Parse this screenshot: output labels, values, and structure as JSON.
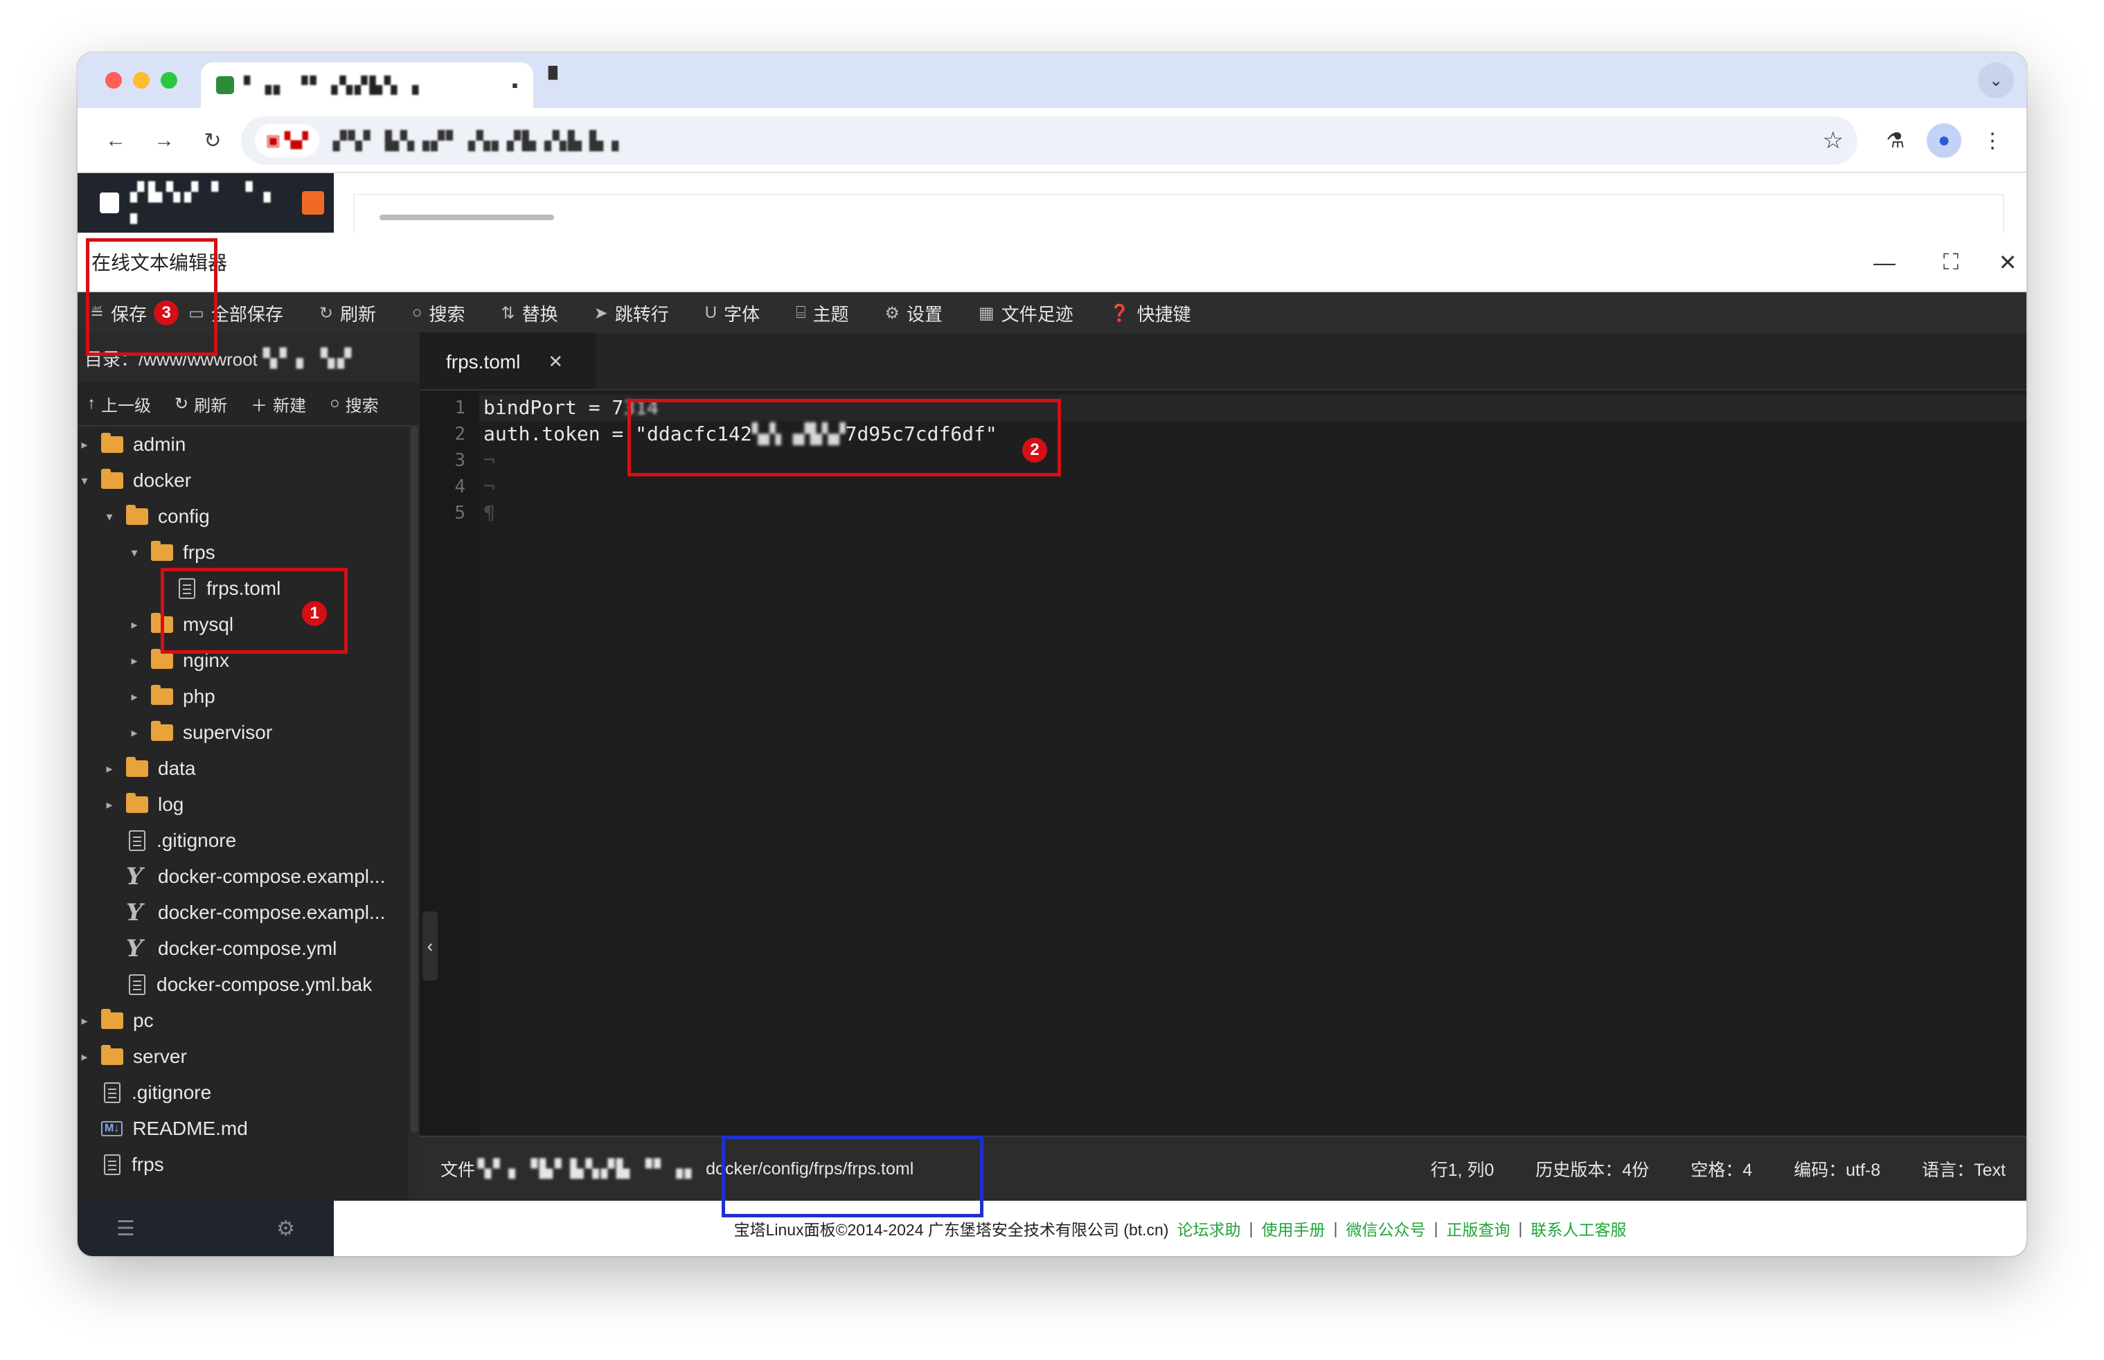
{
  "browser": {
    "tab_title": "▘▗▖ ▝▘▗▚▞▙▚ ▗",
    "tab_close": "▪",
    "new_tab": "▘",
    "tab_menu": "⌄",
    "chip_text": "▣ ▚▞",
    "url": "▞▚▘ ▙▚▗▞▘▗▚▖▞▙▗▚▙ ▙▗",
    "back": "←",
    "forward": "→",
    "reload": "↻",
    "star": "☆",
    "labs": "⚗",
    "profile": "●",
    "menu": "⋮"
  },
  "panel": {
    "logo_text": "▞▙▚▞ ▘ ▝▗ ▖"
  },
  "dialog": {
    "title": "在线文本编辑器",
    "minimize": "—",
    "maximize": "⛶",
    "close": "✕"
  },
  "toolbar": {
    "save": "保存",
    "save_badge": "3",
    "save_all": "全部保存",
    "refresh": "刷新",
    "search": "搜索",
    "replace": "替换",
    "goto": "跳转行",
    "font": "字体",
    "theme": "主题",
    "settings": "设置",
    "history": "文件足迹",
    "shortcuts": "快捷键"
  },
  "sidebar": {
    "path_label": "目录：/www/wwwroot",
    "path_blur": "▚▘▖ ▚▞",
    "up": "上一级",
    "refresh": "刷新",
    "new": "新建",
    "search": "搜索",
    "tree": [
      {
        "label": "admin"
      },
      {
        "label": "docker"
      },
      {
        "label": "config"
      },
      {
        "label": "frps"
      },
      {
        "label": "frps.toml"
      },
      {
        "label": "mysql"
      },
      {
        "label": "nginx"
      },
      {
        "label": "php"
      },
      {
        "label": "supervisor"
      },
      {
        "label": "data"
      },
      {
        "label": "log"
      },
      {
        "label": ".gitignore"
      },
      {
        "label": "docker-compose.exampl..."
      },
      {
        "label": "docker-compose.exampl..."
      },
      {
        "label": "docker-compose.yml"
      },
      {
        "label": "docker-compose.yml.bak"
      },
      {
        "label": "pc"
      },
      {
        "label": "server"
      },
      {
        "label": ".gitignore"
      },
      {
        "label": "README.md"
      },
      {
        "label": "frps"
      }
    ],
    "badge_1": "1"
  },
  "editor": {
    "tab_label": "frps.toml",
    "tab_close": "✕",
    "line_numbers": [
      "1",
      "2",
      "3",
      "4",
      "5"
    ],
    "line1_key": "bindPort = 7",
    "line1_blur": "314",
    "line2_key": "auth.token = ",
    "line2_val_start": "\"ddacfc142",
    "line2_val_blur": "▚▞▖▗▞▙▚▞",
    "line2_val_end": "7d95c7cdf6df\"",
    "line_end_marks": [
      "¬",
      "¬",
      "¶"
    ],
    "badge_2": "2"
  },
  "status": {
    "file_prefix": "文件",
    "file_blur": "▚▘▖▝▙▘▙▚▞▙  ▝▘▗▖",
    "file_path": "docker/config/frps/frps.toml",
    "cursor": "行1, 列0",
    "history": "历史版本：4份",
    "spaces": "空格：4",
    "encoding": "编码：utf-8",
    "language": "语言：Text"
  },
  "footer": {
    "copyright": "宝塔Linux面板©2014-2024 广东堡塔安全技术有限公司 (bt.cn)",
    "links": [
      "论坛求助",
      "使用手册",
      "微信公众号",
      "正版查询",
      "联系人工客服"
    ],
    "separator": "|"
  },
  "bottom_icons": {
    "menu": "☰",
    "settings": "⚙"
  }
}
